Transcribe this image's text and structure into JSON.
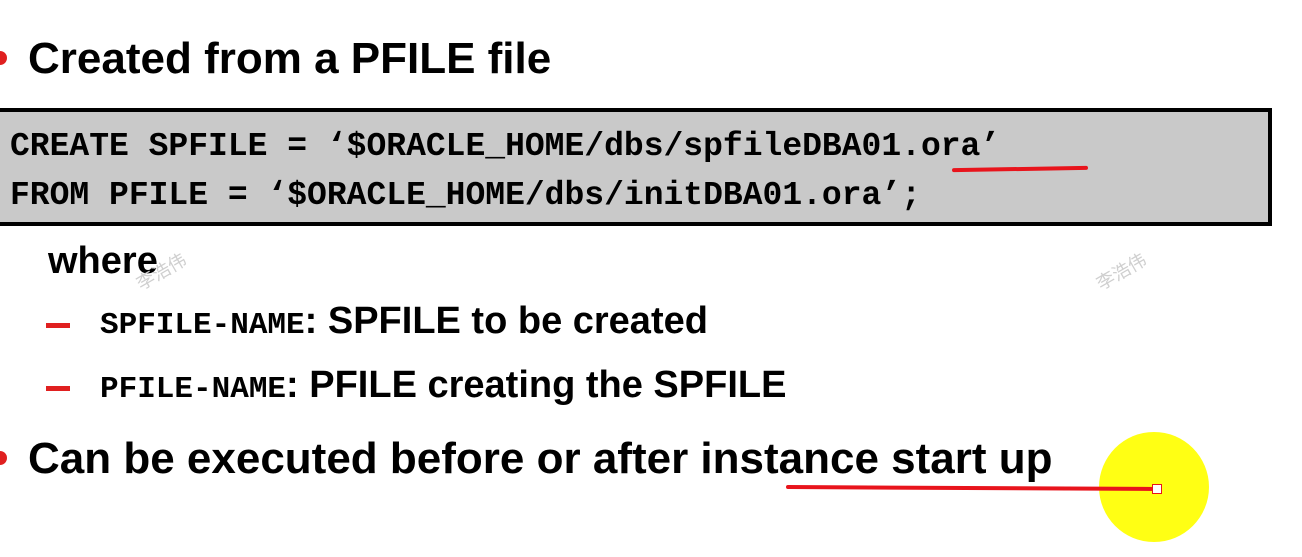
{
  "slide": {
    "bullet_1": "Created from a PFILE file",
    "code": {
      "line_1": "CREATE SPFILE = ‘$ORACLE_HOME/dbs/spfileDBA01.ora’",
      "line_2": "FROM PFILE = ‘$ORACLE_HOME/dbs/initDBA01.ora’;"
    },
    "where_label": "where",
    "sub_items": [
      {
        "term": "SPFILE-NAME",
        "description": ": SPFILE to be created"
      },
      {
        "term": "PFILE-NAME",
        "description": ": PFILE creating the SPFILE"
      }
    ],
    "bullet_2": "Can be executed before or after instance start up"
  },
  "watermarks": [
    "李浩伟",
    "李浩伟"
  ],
  "colors": {
    "bullet": "#e02020",
    "dash": "#e02020",
    "pen_annotation": "#e8141c",
    "code_background": "#c9c9c9",
    "cursor_highlight": "#ffff00"
  }
}
